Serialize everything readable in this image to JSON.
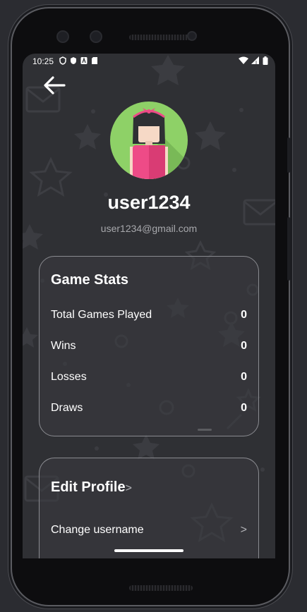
{
  "status_bar": {
    "time": "10:25",
    "icons": [
      "shield-icon",
      "shield-filled-icon",
      "app-a-icon",
      "sd-card-icon"
    ],
    "right_icons": [
      "wifi-icon",
      "signal-icon",
      "battery-icon"
    ]
  },
  "profile": {
    "username": "user1234",
    "email": "user1234@gmail.com"
  },
  "game_stats": {
    "title": "Game Stats",
    "rows": [
      {
        "label": "Total Games Played",
        "value": "0"
      },
      {
        "label": "Wins",
        "value": "0"
      },
      {
        "label": "Losses",
        "value": "0"
      },
      {
        "label": "Draws",
        "value": "0"
      }
    ]
  },
  "edit_profile": {
    "title": "Edit Profile",
    "title_chevron": ">",
    "items": [
      {
        "label": "Change username",
        "chevron": ">"
      }
    ]
  },
  "colors": {
    "background": "#2f3034",
    "card_border": "#8a8b90",
    "avatar_bg": "#8ed167",
    "avatar_shirt": "#ee4b87"
  }
}
